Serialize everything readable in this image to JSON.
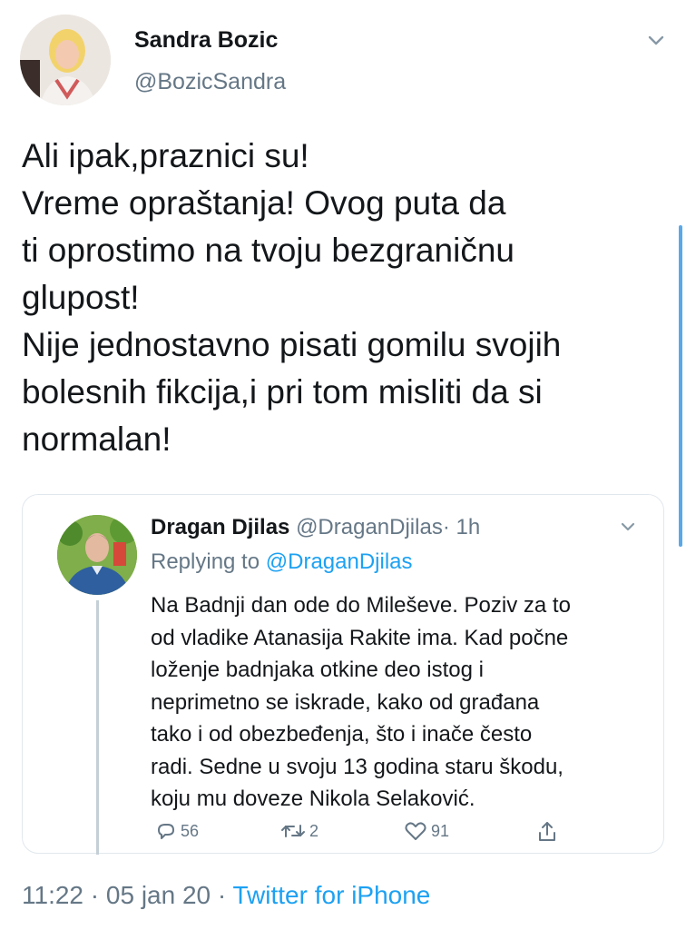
{
  "author": {
    "name": "Sandra Bozic",
    "handle": "@BozicSandra"
  },
  "tweet": {
    "lines": [
      "Ali ipak,praznici su!",
      "Vreme opraštanja! Ovog puta da",
      "ti oprostimo na tvoju bezgraničnu",
      "glupost!",
      "Nije jednostavno pisati gomilu svojih",
      "bolesnih fikcija,i pri tom misliti da si",
      "normalan!"
    ]
  },
  "quoted": {
    "name": "Dragan Djilas",
    "handle": "@DraganDjilas",
    "time": "· 1h",
    "replying_prefix": "Replying to ",
    "replying_to": "@DraganDjilas",
    "lines": [
      "Na Badnji dan ode do Mileševe. Poziv za to",
      "od vladike Atanasija Rakite ima. Kad počne",
      "loženje badnjaka otkine deo istog i",
      "neprimetno se iskrade, kako od građana",
      "tako i od obezbeđenja, što i inače često",
      "radi. Sedne u svoju 13 godina staru škodu,",
      "koju mu doveze Nikola Selaković."
    ],
    "actions": {
      "replies": "56",
      "retweets": "2",
      "likes": "91"
    }
  },
  "footer": {
    "time": "11:22",
    "date": "05 jan 20",
    "sep": "·",
    "source": "Twitter for iPhone"
  },
  "icons": [
    "chevron-down-icon",
    "reply-icon",
    "retweet-icon",
    "like-icon",
    "share-icon"
  ],
  "colors": {
    "link": "#1da1f2",
    "muted": "#657786",
    "text": "#14171a"
  }
}
